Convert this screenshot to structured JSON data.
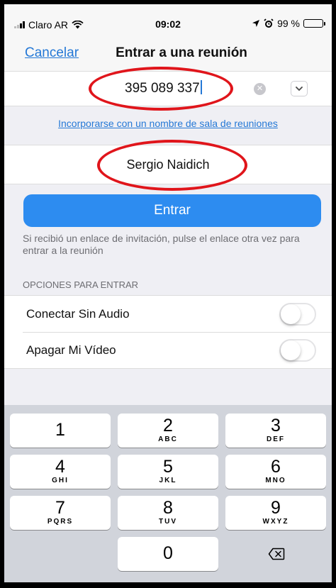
{
  "status_bar": {
    "carrier": "Claro AR",
    "time": "09:02",
    "battery": "99 %"
  },
  "nav": {
    "cancel_label": "Cancelar",
    "title": "Entrar a una reunión"
  },
  "meeting_id": {
    "value": "395 089 337"
  },
  "room_name_link": "Incorporarse con un nombre de sala de reuniones",
  "display_name": {
    "value": "Sergio Naidich"
  },
  "join_button_label": "Entrar",
  "invitation_hint": "Si recibió un enlace de invitación, pulse el enlace otra vez para entrar a la reunión",
  "options": {
    "header": "OPCIONES PARA ENTRAR",
    "items": [
      {
        "label": "Conectar Sin Audio",
        "enabled": false
      },
      {
        "label": "Apagar Mi Vídeo",
        "enabled": false
      }
    ]
  },
  "keypad": {
    "keys": [
      {
        "num": "1",
        "letters": ""
      },
      {
        "num": "2",
        "letters": "ABC"
      },
      {
        "num": "3",
        "letters": "DEF"
      },
      {
        "num": "4",
        "letters": "GHI"
      },
      {
        "num": "5",
        "letters": "JKL"
      },
      {
        "num": "6",
        "letters": "MNO"
      },
      {
        "num": "7",
        "letters": "PQRS"
      },
      {
        "num": "8",
        "letters": "TUV"
      },
      {
        "num": "9",
        "letters": "WXYZ"
      },
      {
        "num": "0",
        "letters": ""
      }
    ]
  },
  "colors": {
    "accent": "#2478d6",
    "join_button": "#2d8cf0",
    "annotation_ring": "#e0151b"
  }
}
